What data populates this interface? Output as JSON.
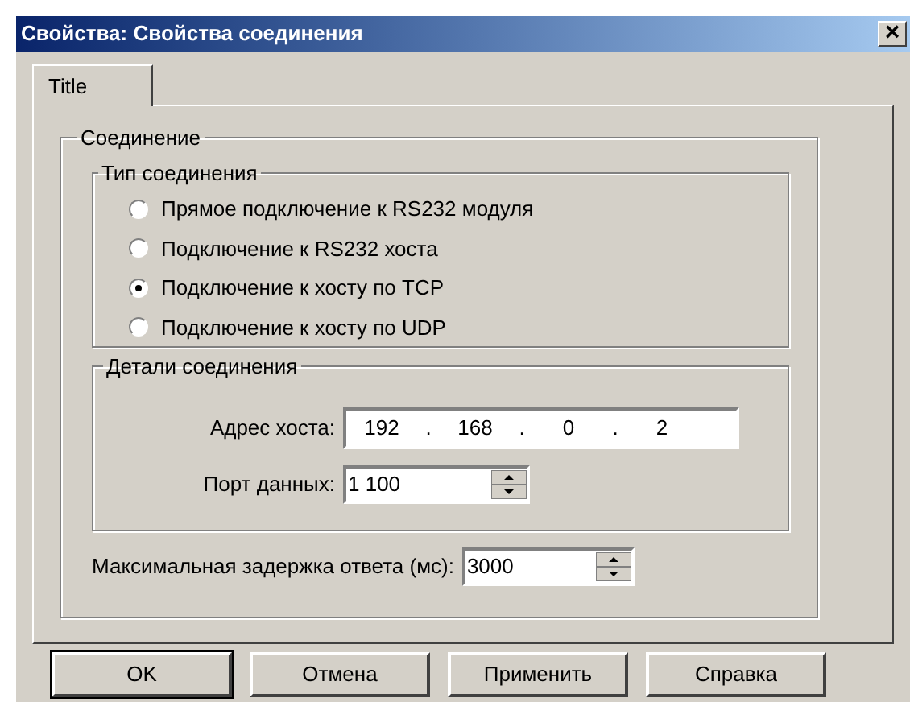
{
  "window": {
    "title": "Свойства: Свойства соединения",
    "close": "×"
  },
  "tabs": [
    {
      "label": "Title",
      "selected": true
    }
  ],
  "group": {
    "title": "Соединение",
    "connection_type": {
      "title": "Тип соединения",
      "options": [
        {
          "label": "Прямое подключение к RS232 модуля",
          "selected": false
        },
        {
          "label": "Подключение к RS232 хоста",
          "selected": false
        },
        {
          "label": "Подключение к хосту по TCP",
          "selected": true
        },
        {
          "label": "Подключение к хосту по UDP",
          "selected": false
        }
      ]
    },
    "details": {
      "title": "Детали соединения",
      "host_address": {
        "label": "Адрес хоста:",
        "octets": [
          "192",
          "168",
          "0",
          "2"
        ],
        "separator": "."
      },
      "data_port": {
        "label": "Порт данных:",
        "value": "1 100"
      }
    },
    "max_delay": {
      "label": "Максимальная задержка ответа (мс):",
      "value": "3000"
    }
  },
  "buttons": [
    {
      "label": "OK",
      "default": true
    },
    {
      "label": "Отмена",
      "default": false
    },
    {
      "label": "Применить",
      "default": false
    },
    {
      "label": "Справка",
      "default": false
    }
  ]
}
